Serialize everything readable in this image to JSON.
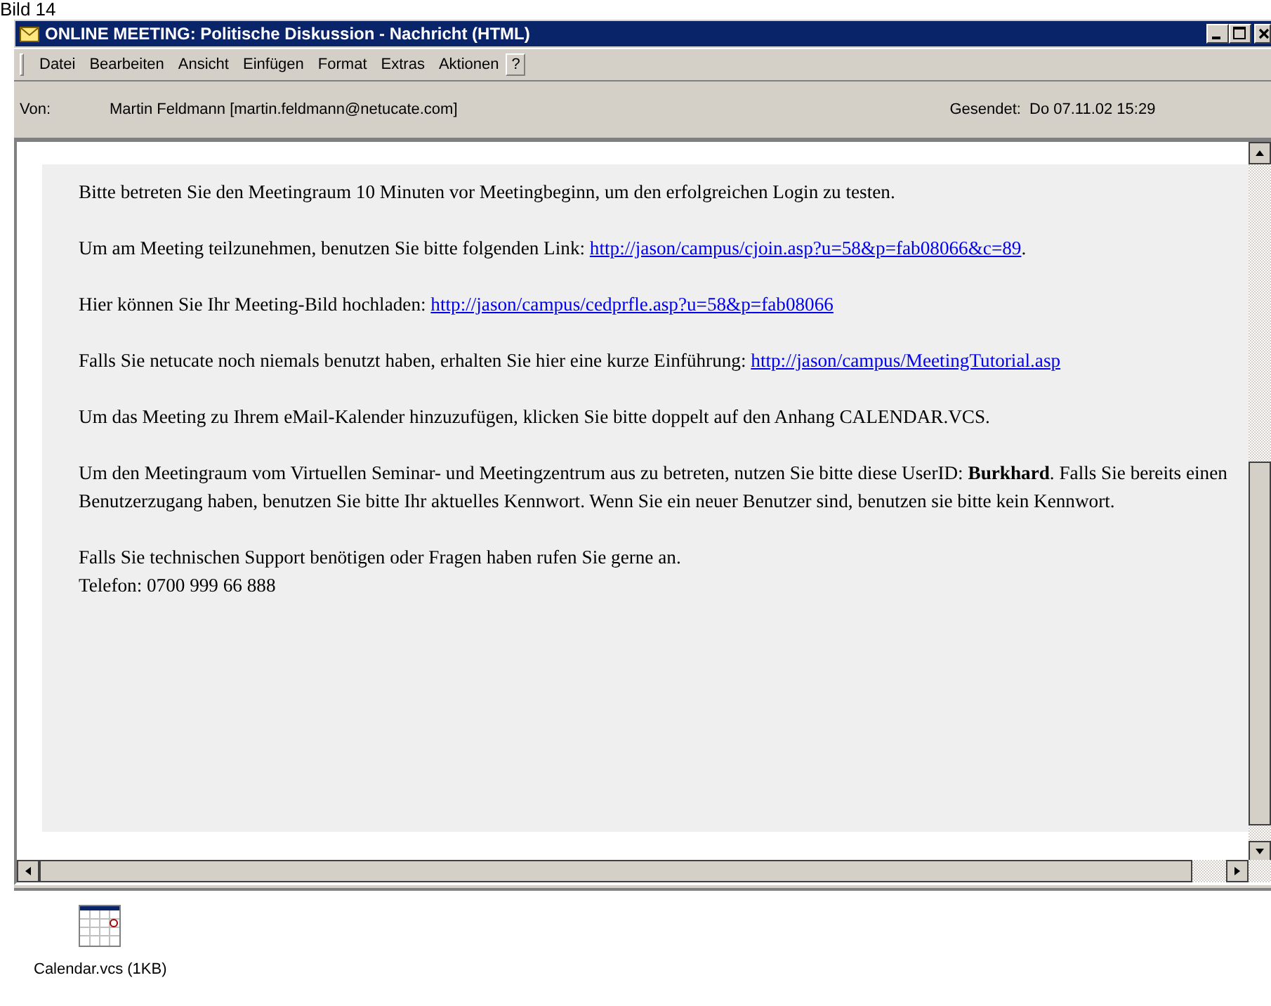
{
  "caption": "Bild 14",
  "window": {
    "title": "ONLINE MEETING: Politische Diskussion - Nachricht (HTML)"
  },
  "menu": [
    {
      "kind": "menu",
      "label": "Datei"
    },
    {
      "kind": "menu",
      "label": "Bearbeiten"
    },
    {
      "kind": "menu",
      "label": "Ansicht"
    },
    {
      "kind": "menu",
      "label": "Einfügen"
    },
    {
      "kind": "menu",
      "label": "Format"
    },
    {
      "kind": "menu",
      "label": "Extras"
    },
    {
      "kind": "menu",
      "label": "Aktionen"
    },
    {
      "kind": "help",
      "label": "?"
    }
  ],
  "header": {
    "from_label": "Von:",
    "from": "Martin Feldmann [martin.feldmann@netucate.com]",
    "sent_label": "Gesendet:",
    "sent": "Do 07.11.02 15:29"
  },
  "message": [
    {
      "lines": [
        [
          {
            "kind": "text",
            "text": "Bitte betreten Sie den Meetingraum 10 Minuten vor Meetingbeginn, um den erfolgreichen Login zu testen."
          }
        ]
      ]
    },
    {
      "lines": [
        [
          {
            "kind": "text",
            "text": "Um am Meeting teilzunehmen, benutzen Sie bitte folgenden Link: "
          },
          {
            "kind": "link",
            "text": "http://jason/campus/cjoin.asp?u=58&p=fab08066&c=89"
          },
          {
            "kind": "text",
            "text": "."
          }
        ]
      ]
    },
    {
      "lines": [
        [
          {
            "kind": "text",
            "text": "Hier können Sie Ihr Meeting-Bild hochladen: "
          },
          {
            "kind": "link",
            "text": "http://jason/campus/cedprfle.asp?u=58&p=fab08066"
          }
        ]
      ]
    },
    {
      "lines": [
        [
          {
            "kind": "text",
            "text": "Falls Sie netucate noch niemals benutzt haben, erhalten Sie hier eine kurze Einführung: "
          },
          {
            "kind": "link",
            "text": "http://jason/campus/MeetingTutorial.asp"
          }
        ]
      ]
    },
    {
      "lines": [
        [
          {
            "kind": "text",
            "text": "Um das Meeting zu Ihrem eMail-Kalender hinzuzufügen, klicken Sie bitte doppelt auf den Anhang CALENDAR.VCS."
          }
        ]
      ]
    },
    {
      "lines": [
        [
          {
            "kind": "text",
            "text": "Um den Meetingraum vom Virtuellen Seminar- und Meetingzentrum aus zu betreten, nutzen Sie bitte diese UserID: **Burkhard**. Falls Sie bereits einen Benutzerzugang haben, benutzen Sie bitte Ihr aktuelles Kennwort. Wenn Sie ein neuer Benutzer sind, benutzen sie bitte kein Kennwort."
          }
        ]
      ]
    },
    {
      "lines": [
        [
          {
            "kind": "text",
            "text": "Falls Sie technischen Support benötigen oder Fragen haben rufen Sie gerne an."
          }
        ],
        [
          {
            "kind": "text",
            "text": "Telefon: 0700 999 66 888"
          }
        ]
      ]
    }
  ],
  "attachments": [
    {
      "name": "Calendar.vcs (1KB)"
    }
  ]
}
